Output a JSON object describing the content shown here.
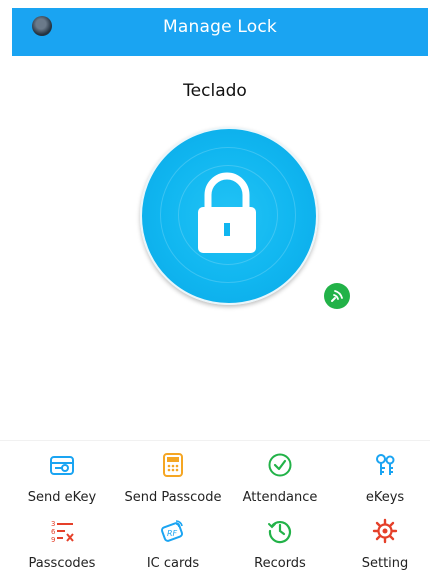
{
  "header": {
    "title": "Manage Lock"
  },
  "lock": {
    "name": "Teclado"
  },
  "menu": [
    {
      "label": "Send eKey",
      "icon": "send-ekey-icon",
      "color": "#1aa4f2"
    },
    {
      "label": "Send Passcode",
      "icon": "send-passcode-icon",
      "color": "#f5a623"
    },
    {
      "label": "Attendance",
      "icon": "attendance-icon",
      "color": "#22b248"
    },
    {
      "label": "eKeys",
      "icon": "ekeys-icon",
      "color": "#1aa4f2"
    },
    {
      "label": "Passcodes",
      "icon": "passcodes-icon",
      "color": "#e5402a"
    },
    {
      "label": "IC cards",
      "icon": "ic-cards-icon",
      "color": "#1aa4f2"
    },
    {
      "label": "Records",
      "icon": "records-icon",
      "color": "#22b248"
    },
    {
      "label": "Setting",
      "icon": "setting-icon",
      "color": "#e5402a"
    }
  ],
  "colors": {
    "header": "#1aa4f2",
    "lock_button": "#10b6f0",
    "bluetooth_badge": "#22b248"
  }
}
